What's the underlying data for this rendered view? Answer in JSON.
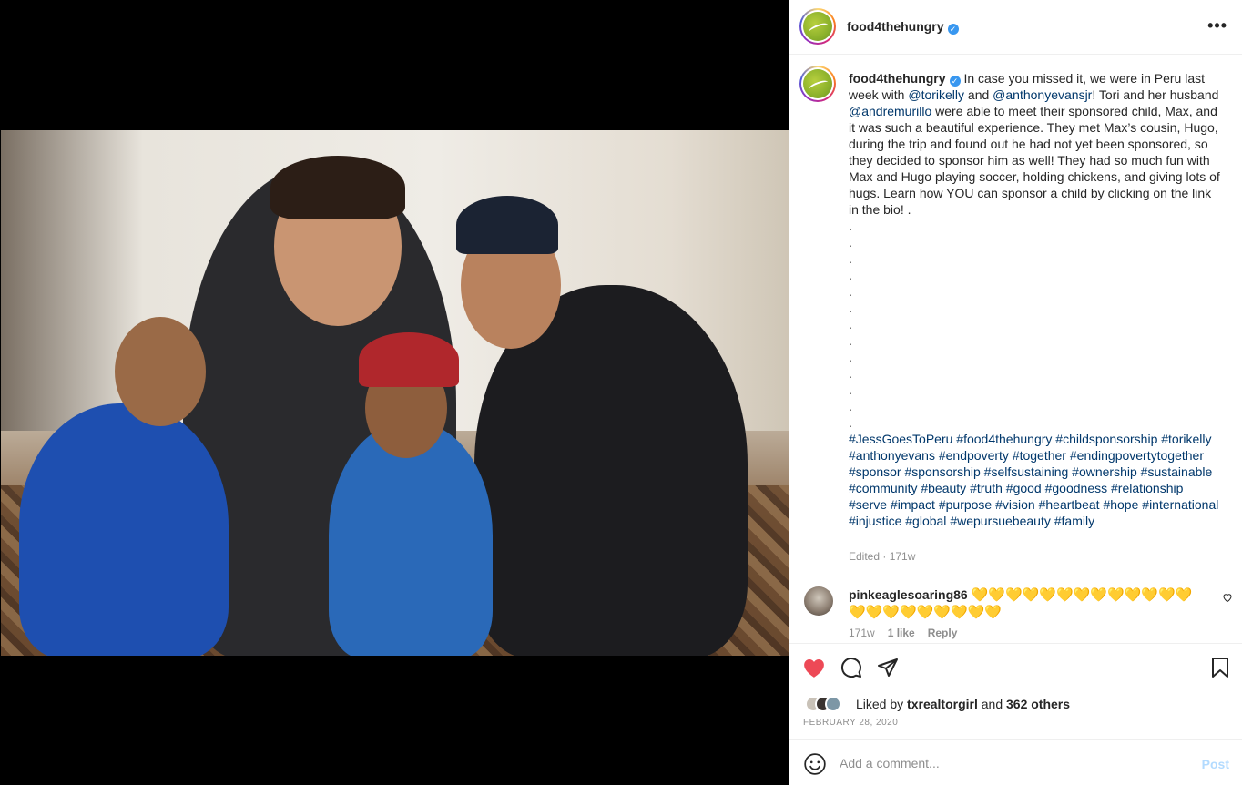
{
  "post": {
    "username": "food4thehungry",
    "verified_mark": "✓",
    "more_label": "•••"
  },
  "caption": {
    "username": "food4thehungry",
    "t1": "In case you missed it, we were in Peru last week with ",
    "m1": "@torikelly",
    "t2": " and ",
    "m2": "@anthonyevansjr",
    "t3": "! Tori and her husband ",
    "m3": "@andremurillo",
    "t4": " were able to meet their sponsored child, Max, and it was such a beautiful experience. They met Max’s cousin, Hugo, during the trip and found out he had not yet been sponsored, so they decided to sponsor him as well! They had so much fun with Max and Hugo playing soccer, holding chickens, and giving lots of hugs. Learn how YOU can sponsor a child by clicking on the link in the bio! .",
    "dots": [
      ".",
      ".",
      ".",
      ".",
      ".",
      ".",
      ".",
      ".",
      ".",
      ".",
      ".",
      ".",
      "."
    ],
    "hashtags": [
      "#JessGoesToPeru",
      "#food4thehungry",
      "#childsponsorship",
      "#torikelly",
      "#anthonyevans",
      "#endpoverty",
      "#together",
      "#endingpovertytogether",
      "#sponsor",
      "#sponsorship",
      "#selfsustaining",
      "#ownership",
      "#sustainable",
      "#community",
      "#beauty",
      "#truth",
      "#good",
      "#goodness",
      "#relationship",
      "#serve",
      "#impact",
      "#purpose",
      "#vision",
      "#heartbeat",
      "#hope",
      "#international",
      "#injustice",
      "#global",
      "#wepursuebeauty",
      "#family"
    ],
    "edited": "Edited",
    "sep": " · ",
    "age": "171w"
  },
  "comment": {
    "username": "pinkeaglesoaring86",
    "text": "💛💛💛💛💛💛💛💛💛💛💛💛💛💛💛💛💛💛💛💛💛💛",
    "age": "171w",
    "likes": "1 like",
    "reply": "Reply"
  },
  "likes": {
    "prefix": "Liked by ",
    "user": "txrealtorgirl",
    "mid": " and ",
    "others": "362 others"
  },
  "date": "FEBRUARY 28, 2020",
  "add_comment": {
    "placeholder": "Add a comment...",
    "post_label": "Post"
  },
  "colors": {
    "heart": "#ed4956",
    "link": "#00376b",
    "verified": "#3897f0"
  }
}
